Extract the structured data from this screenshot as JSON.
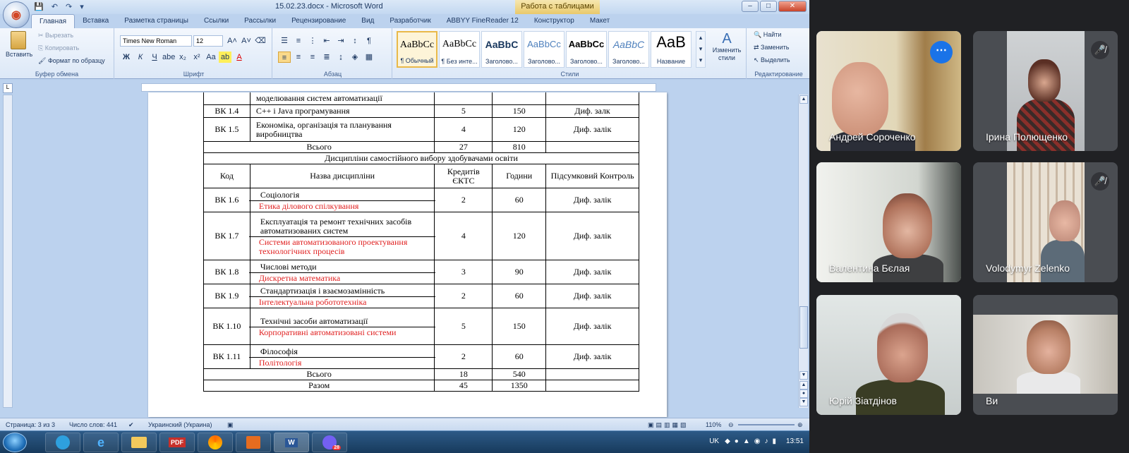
{
  "word": {
    "doc_title": "15.02.23.docx - Microsoft Word",
    "context_tab_title": "Работа с таблицами",
    "tabs": [
      "Главная",
      "Вставка",
      "Разметка страницы",
      "Ссылки",
      "Рассылки",
      "Рецензирование",
      "Вид",
      "Разработчик",
      "ABBYY FineReader 12",
      "Конструктор",
      "Макет"
    ],
    "ribbon": {
      "clipboard": {
        "label": "Буфер обмена",
        "paste": "Вставить",
        "cut": "Вырезать",
        "copy": "Копировать",
        "format_painter": "Формат по образцу"
      },
      "font": {
        "label": "Шрифт",
        "font_name": "Times New Roman",
        "font_size": "12"
      },
      "paragraph": {
        "label": "Абзац"
      },
      "styles": {
        "label": "Стили",
        "items": [
          {
            "sample": "AaBbCc",
            "name": "¶ Обычный"
          },
          {
            "sample": "AaBbCc",
            "name": "¶ Без инте..."
          },
          {
            "sample": "AaBbC",
            "name": "Заголово..."
          },
          {
            "sample": "AaBbCc",
            "name": "Заголово..."
          },
          {
            "sample": "AaBbCc",
            "name": "Заголово..."
          },
          {
            "sample": "AaBbC",
            "name": "Заголово..."
          },
          {
            "sample": "AaB",
            "name": "Название"
          }
        ],
        "change_styles": "Изменить стили"
      },
      "editing": {
        "label": "Редактирование",
        "find": "Найти",
        "replace": "Заменить",
        "select": "Выделить"
      }
    },
    "table": {
      "top_rows": [
        {
          "code": "",
          "name": "моделювання систем автоматизації",
          "credits": "",
          "hours": "",
          "control": ""
        },
        {
          "code": "ВК 1.4",
          "name": "С++ і Java програмування",
          "credits": "5",
          "hours": "150",
          "control": "Диф. залк"
        },
        {
          "code": "ВК 1.5",
          "name": "Економіка, організація та планування виробництва",
          "credits": "4",
          "hours": "120",
          "control": "Диф. залік"
        }
      ],
      "total1": {
        "label": "Всього",
        "credits": "27",
        "hours": "810"
      },
      "section_title": "Дисципліни самостійного вибору здобувачами освіти",
      "headers": {
        "code": "Код",
        "name": "Назва дисципліни",
        "credits": "Кредитів ЄКТС",
        "hours": "Години",
        "control": "Підсумковий Контроль"
      },
      "choice_rows": [
        {
          "code": "ВК 1.6",
          "option1": "Соціологія",
          "option2": "Етика ділового спілкування",
          "credits": "2",
          "hours": "60",
          "control": "Диф. залік"
        },
        {
          "code": "ВК 1.7",
          "option1": "Експлуатація та ремонт технічних засобів автоматизованих систем",
          "option2": "Системи автоматизованого проектування технологічних процесів",
          "credits": "4",
          "hours": "120",
          "control": "Диф. залік"
        },
        {
          "code": "ВК 1.8",
          "option1": "Числові методи",
          "option2": "Дискретна математика",
          "credits": "3",
          "hours": "90",
          "control": "Диф. залік"
        },
        {
          "code": "ВК 1.9",
          "option1": "Стандартизація і взаємозамінність",
          "option2": "Інтелектуальна робототехніка",
          "credits": "2",
          "hours": "60",
          "control": "Диф. залік"
        },
        {
          "code": "ВК 1.10",
          "option1": "Технічні засоби автоматизації",
          "option2": "Корпоративні автоматизовані системи",
          "credits": "5",
          "hours": "150",
          "control": "Диф. залік"
        },
        {
          "code": "ВК 1.11",
          "option1": "Філософія",
          "option2": "Політологія",
          "credits": "2",
          "hours": "60",
          "control": "Диф. залік"
        }
      ],
      "total2": {
        "label": "Всього",
        "credits": "18",
        "hours": "540"
      },
      "grand_total": {
        "label": "Разом",
        "credits": "45",
        "hours": "1350"
      }
    },
    "status": {
      "page": "Страница: 3 из 3",
      "words": "Число слов: 441",
      "language": "Украинский (Украина)",
      "zoom": "110%"
    },
    "taskbar": {
      "apps": [
        "PDF",
        "W"
      ],
      "lang": "UK",
      "time": "13:51",
      "viber_badge": "28"
    }
  },
  "meet": {
    "participants": [
      {
        "name": "Андрей Сороченко",
        "muted": false,
        "active": true
      },
      {
        "name": "Ірина Полющенко",
        "muted": true,
        "active": false
      },
      {
        "name": "Валентина Бєлая",
        "muted": false,
        "active": false
      },
      {
        "name": "Volodymyr Zelenko",
        "muted": true,
        "active": false
      },
      {
        "name": "Юрій Зіатдінов",
        "muted": false,
        "active": false
      },
      {
        "name": "Ви",
        "muted": false,
        "active": false
      }
    ]
  }
}
